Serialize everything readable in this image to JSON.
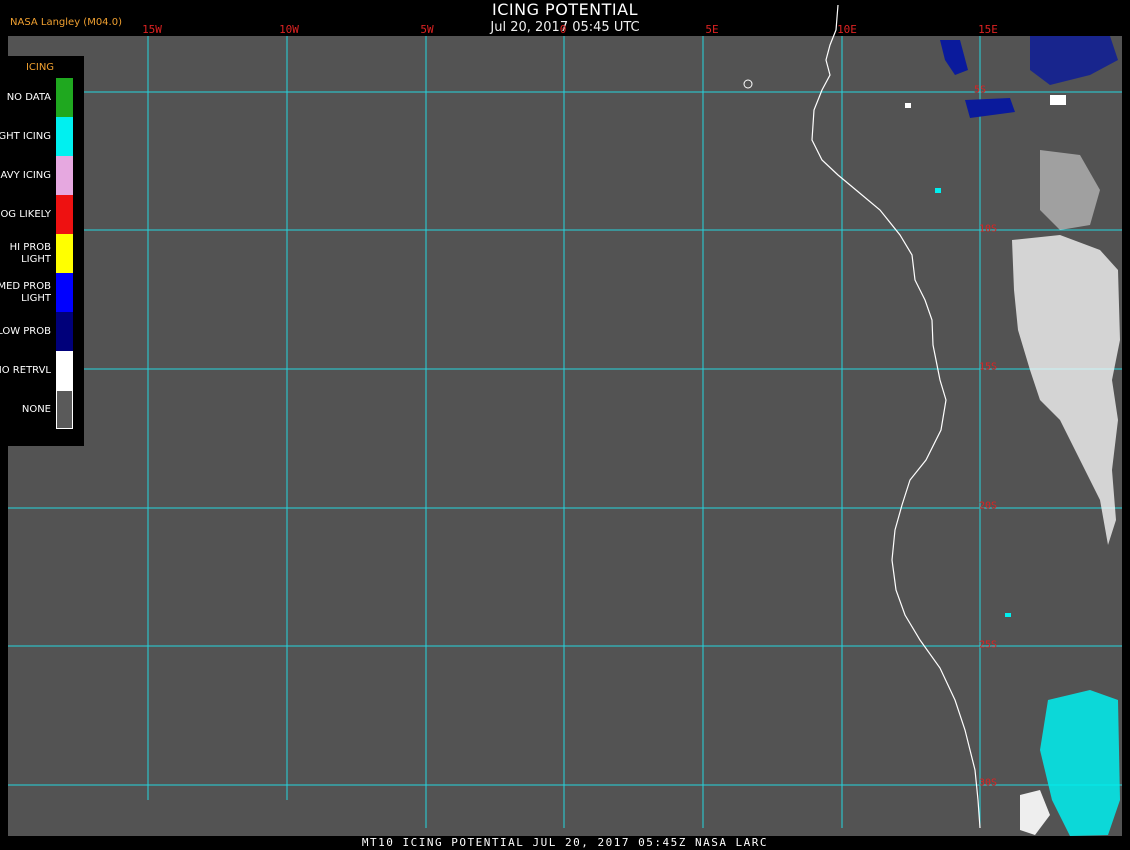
{
  "header": {
    "title": "ICING POTENTIAL",
    "subtitle": "Jul 20, 2017 05:45 UTC",
    "credit": "NASA Langley (M04.0)"
  },
  "footer": {
    "caption": "MT10  ICING POTENTIAL  JUL 20, 2017 05:45Z  NASA LARC"
  },
  "legend": {
    "title": "ICING",
    "items": [
      {
        "label": "NO DATA",
        "color": "#1fa81f"
      },
      {
        "label": "NIGHT ICING",
        "color": "#00f0f0"
      },
      {
        "label": "HEAVY ICING",
        "color": "#e6a8e0"
      },
      {
        "label": "MOG LIKELY",
        "color": "#ee1111"
      },
      {
        "label": "HI PROB LIGHT",
        "color": "#ffff00"
      },
      {
        "label": "MED PROB LIGHT",
        "color": "#0000ff"
      },
      {
        "label": "LOW PROB",
        "color": "#00007a"
      },
      {
        "label": "NO RETRVL",
        "color": "#ffffff"
      },
      {
        "label": "NONE",
        "color": "#5a5a5a"
      }
    ]
  },
  "map": {
    "background_color": "#535353",
    "grid_color": "#25d4dc",
    "coastline_color": "#ffffff",
    "longitude_labels": [
      "15W",
      "10W",
      "5W",
      "0",
      "5E",
      "10E",
      "15E"
    ],
    "latitude_labels": [
      "5S",
      "10S",
      "15S",
      "20S",
      "25S",
      "30S"
    ]
  }
}
